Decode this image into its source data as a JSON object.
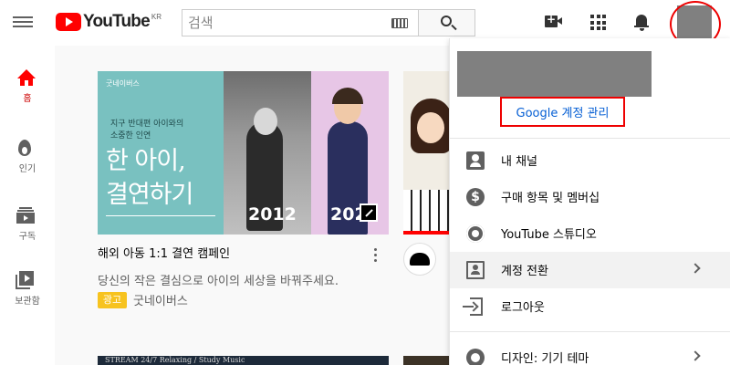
{
  "header": {
    "logo_text": "YouTube",
    "region": "KR",
    "search_placeholder": "검색"
  },
  "sidebar": {
    "items": [
      {
        "label": "홈",
        "icon": "home-icon",
        "active": true
      },
      {
        "label": "인기",
        "icon": "trending-icon",
        "active": false
      },
      {
        "label": "구독",
        "icon": "subscriptions-icon",
        "active": false
      },
      {
        "label": "보관함",
        "icon": "library-icon",
        "active": false
      }
    ]
  },
  "video": {
    "thumb_brand": "굿네이버스",
    "thumb_subtitle_line1": "지구 반대편 아이와의",
    "thumb_subtitle_line2": "소중한 인연",
    "thumb_headline_line1": "한 아이,",
    "thumb_headline_line2": "결연하기",
    "year_left": "2012",
    "year_right": "202",
    "title": "해외 아동 1:1 결연 캠페인",
    "description": "당신의 작은 결심으로 아이의 세상을 바꿔주세요.",
    "ad_label": "광고",
    "channel": "굿네이버스"
  },
  "bottom_thumb_text": "STREAM 24/7 Relaxing / Study Music",
  "account_menu": {
    "manage_account": "Google 계정 관리",
    "items": [
      {
        "label": "내 채널",
        "icon": "person-icon",
        "chevron": false
      },
      {
        "label": "구매 항목 및 멤버십",
        "icon": "dollar-icon",
        "chevron": false
      },
      {
        "label": "YouTube 스튜디오",
        "icon": "gear-icon",
        "chevron": false
      },
      {
        "label": "계정 전환",
        "icon": "switch-account-icon",
        "chevron": true
      },
      {
        "label": "로그아웃",
        "icon": "logout-icon",
        "chevron": false
      },
      {
        "label": "디자인: 기기 테마",
        "icon": "theme-icon",
        "chevron": true
      }
    ]
  },
  "colors": {
    "brand_red": "#ff0000",
    "link_blue": "#065fd4",
    "ad_yellow": "#f7c31f",
    "highlight_red": "#ee0000"
  }
}
